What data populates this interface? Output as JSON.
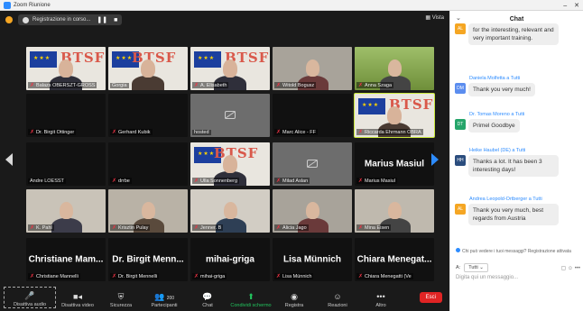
{
  "window": {
    "title": "Zoom Riunione"
  },
  "recording": {
    "label": "Registrazione in corso..."
  },
  "view": {
    "label": "Vista"
  },
  "gallery": [
    {
      "name": "Balazs OBERSZT-GROSS",
      "muted": true
    },
    {
      "name": "Gorgia",
      "muted": false
    },
    {
      "name": "A. Elisabeth",
      "muted": true
    },
    {
      "name": "Witold Bogusz",
      "muted": true
    },
    {
      "name": "Anna Szaga",
      "muted": true
    },
    {
      "name": "Dr. Birgit Ottinger",
      "muted": true
    },
    {
      "name": "Gerhard Kubik",
      "muted": true
    },
    {
      "name": "hosted",
      "muted": false
    },
    {
      "name": "Marc Alice - FF",
      "muted": true
    },
    {
      "name": "Riccarda Ehrmann OBRA",
      "muted": true
    },
    {
      "name": "Andre LOESST",
      "muted": false
    },
    {
      "name": "drrbe",
      "muted": true
    },
    {
      "name": "Ulla Sonnenberg",
      "muted": true
    },
    {
      "name": "Milad Aslan",
      "muted": true
    },
    {
      "name": "Marius Masiul",
      "muted": true,
      "big": "Marius Masiul"
    },
    {
      "name": "K. Pahl",
      "muted": true
    },
    {
      "name": "Krisztin Pulay",
      "muted": true
    },
    {
      "name": "Jenner. B",
      "muted": true
    },
    {
      "name": "Alicia Jago",
      "muted": true
    },
    {
      "name": "Mina Eisen",
      "muted": true
    },
    {
      "name": "Christiane Mannelli",
      "muted": true,
      "big": "Christiane Mam..."
    },
    {
      "name": "Dr. Birgit Mennelli",
      "muted": true,
      "big": "Dr. Birgit Menn..."
    },
    {
      "name": "mihai-griga",
      "muted": true,
      "big": "mihai-griga"
    },
    {
      "name": "Lisa Münnich",
      "muted": true,
      "big": "Lisa Münnich"
    },
    {
      "name": "Chiara Menegatti (Ve",
      "muted": true,
      "big": "Chiara Menegat..."
    }
  ],
  "toolbar": [
    {
      "label": "Disattiva audio",
      "icon": "microphone-icon"
    },
    {
      "label": "Disattiva video",
      "icon": "video-camera-icon"
    },
    {
      "label": "Sicurezza",
      "icon": "shield-icon"
    },
    {
      "label": "Partecipanti",
      "icon": "participants-icon",
      "count": "200"
    },
    {
      "label": "Chat",
      "icon": "chat-bubble-icon"
    },
    {
      "label": "Condividi schermo",
      "icon": "share-screen-icon"
    },
    {
      "label": "Registra",
      "icon": "record-icon"
    },
    {
      "label": "Reazioni",
      "icon": "smiley-icon"
    },
    {
      "label": "Altro",
      "icon": "more-icon"
    }
  ],
  "end_label": "Esci",
  "chat": {
    "title": "Chat",
    "messages": [
      {
        "sender": "",
        "avatar": "AL",
        "avatar_color": "#f5a623",
        "text": "for the interesting, relevant and very important training."
      },
      {
        "sender": "Daniela Molfetta a Tutti",
        "avatar": "DM",
        "avatar_color": "#5b8def",
        "text": "Thank you very much!"
      },
      {
        "sender": "Dr. Tomas Moreno a Tutti",
        "avatar": "DT",
        "avatar_color": "#25a56a",
        "text": "Primel Goodbye"
      },
      {
        "sender": "Heike Haubel (DE) a Tutti",
        "avatar": "HH",
        "avatar_color": "#2b4d7e",
        "text": "Thanks a lot. It has been 3 interesting days!"
      },
      {
        "sender": "Andrea Leopold-Ortberger a Tutti",
        "avatar": "AL",
        "avatar_color": "#f5a623",
        "text": "Thank you very much, best regards from Austria"
      }
    ],
    "note": "Chi può vedere i tuoi messaggi? Registrazione attivata",
    "to_label": "A:",
    "to_value": "Tutti",
    "input_placeholder": "Digita qui un messaggio..."
  }
}
